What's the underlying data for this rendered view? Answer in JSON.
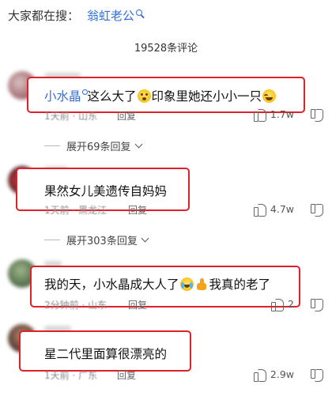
{
  "search": {
    "prefix": "大家都在搜：",
    "term": "翁虹老公",
    "icon": "search-icon"
  },
  "comment_count": "19528条评论",
  "comments": [
    {
      "text_pre": "",
      "mention": "小水晶",
      "text_post": "这么大了",
      "text_mid": "印象里她还小小一只",
      "meta": "1天前 · 山东",
      "reply": "回复",
      "likes": "1.7w",
      "expand": ""
    },
    {
      "text": "果然女儿美遗传自妈妈",
      "meta": "1天前 · 黑龙江",
      "reply": "回复",
      "likes": "4.7w",
      "expand": "展开69条回复"
    },
    {
      "text_a": "我的天，小水晶成大人了",
      "text_b": "我真的老了",
      "meta": "2分钟前 · 山东",
      "reply": "回复",
      "likes": "2",
      "expand": "展开303条回复"
    },
    {
      "text": "星二代里面算很漂亮的",
      "meta": "1天前 · 广东",
      "reply": "回复",
      "likes": "2.9w",
      "expand": ""
    }
  ],
  "colors": {
    "highlight": "#e0202a",
    "link": "#2f6fd6"
  }
}
